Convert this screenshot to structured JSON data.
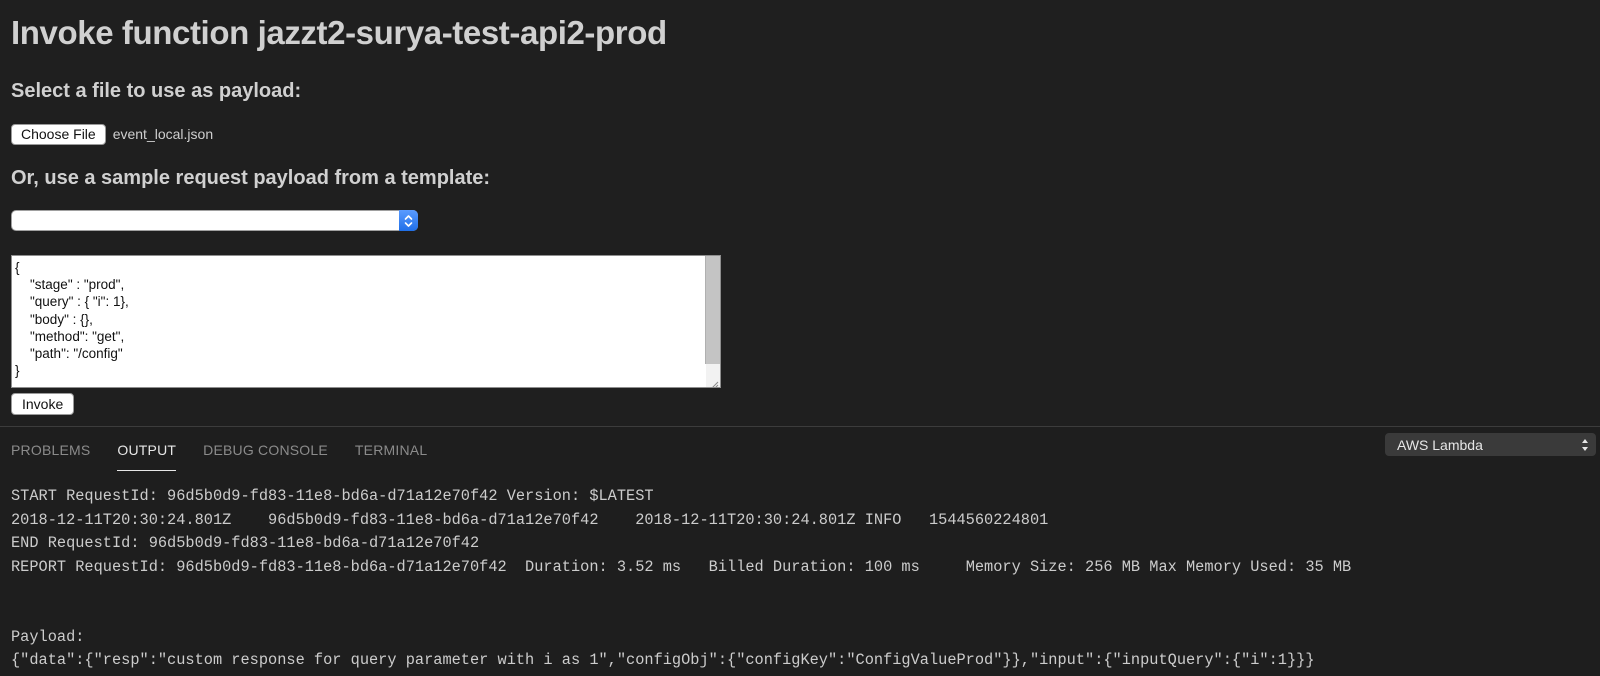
{
  "webview": {
    "title": "Invoke function jazzt2-surya-test-api2-prod",
    "file_section_label": "Select a file to use as payload:",
    "choose_file_label": "Choose File",
    "selected_file": "event_local.json",
    "template_section_label": "Or, use a sample request payload from a template:",
    "template_selected": "",
    "payload_text": "{\n    \"stage\" : \"prod\",\n    \"query\" : { \"i\": 1},\n    \"body\" : {},\n    \"method\": \"get\",\n    \"path\": \"/config\"\n}",
    "invoke_label": "Invoke"
  },
  "panel": {
    "tabs": [
      {
        "label": "PROBLEMS",
        "active": false
      },
      {
        "label": "OUTPUT",
        "active": true
      },
      {
        "label": "DEBUG CONSOLE",
        "active": false
      },
      {
        "label": "TERMINAL",
        "active": false
      }
    ],
    "output_channel": "AWS Lambda",
    "output_lines": [
      "",
      "START RequestId: 96d5b0d9-fd83-11e8-bd6a-d71a12e70f42 Version: $LATEST",
      "2018-12-11T20:30:24.801Z\t96d5b0d9-fd83-11e8-bd6a-d71a12e70f42\t2018-12-11T20:30:24.801Z INFO\t1544560224801",
      "END RequestId: 96d5b0d9-fd83-11e8-bd6a-d71a12e70f42",
      "REPORT RequestId: 96d5b0d9-fd83-11e8-bd6a-d71a12e70f42  Duration: 3.52 ms\tBilled Duration: 100 ms \tMemory Size: 256 MB Max Memory Used: 35 MB",
      "",
      "",
      "Payload:",
      "{\"data\":{\"resp\":\"custom response for query parameter with i as 1\",\"configObj\":{\"configKey\":\"ConfigValueProd\"}},\"input\":{\"inputQuery\":{\"i\":1}}}"
    ]
  },
  "colors": {
    "background": "#1f1f1f",
    "select_accent": "#1f6fe8",
    "active_tab": "#e7e7e7",
    "inactive_tab": "#8b8b8b"
  },
  "icons": [
    "select-updown-arrows-icon",
    "resize-grip-icon",
    "dropdown-updown-icon"
  ]
}
